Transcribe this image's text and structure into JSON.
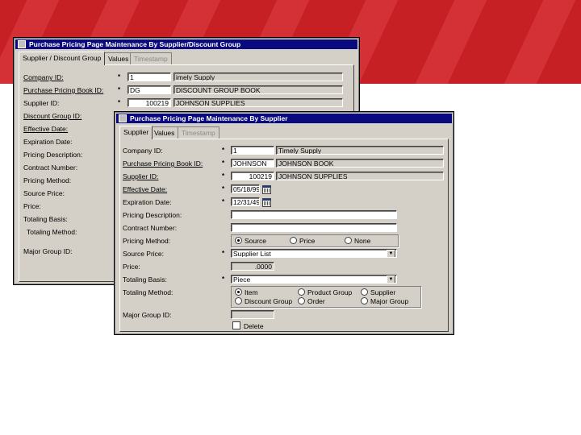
{
  "colors": {
    "banner": "#c62025",
    "titlebar": "#0a0a80",
    "window": "#d4d0c8"
  },
  "back_window": {
    "title": "Purchase Pricing Page Maintenance By Supplier/Discount Group",
    "tabs": [
      {
        "label": "Supplier / Discount Group",
        "active": true
      },
      {
        "label": "Values"
      },
      {
        "label": "Timestamp",
        "disabled": true
      }
    ],
    "fields": {
      "company_id": {
        "label": "Company ID:",
        "value": "1",
        "desc": "imely Supply"
      },
      "price_book_id": {
        "label": "Purchase Pricing Book ID:",
        "value": "DG",
        "desc": "DISCOUNT GROUP BOOK"
      },
      "supplier_id": {
        "label": "Supplier ID:",
        "value": "100219",
        "desc": "JOHNSON SUPPLIES"
      },
      "discount_group_id": {
        "label": "Discount Group ID:"
      },
      "effective_date": {
        "label": "Effective Date:"
      },
      "expiration_date": {
        "label": "Expiration Date:"
      },
      "pricing_description": {
        "label": "Pricing Description:"
      },
      "contract_number": {
        "label": "Contract Number:"
      },
      "pricing_method": {
        "label": "Pricing Method:"
      },
      "source_price": {
        "label": "Source Price:"
      },
      "price": {
        "label": "Price:"
      },
      "totaling_basis": {
        "label": "Totaling Basis:"
      },
      "totaling_method": {
        "label": "Totaling Method:"
      },
      "major_group_id": {
        "label": "Major Group ID:"
      }
    },
    "required_mark": "*"
  },
  "front_window": {
    "title": "Purchase Pricing Page Maintenance By Supplier",
    "tabs": [
      {
        "label": "Supplier",
        "active": true
      },
      {
        "label": "Values"
      },
      {
        "label": "Timestamp",
        "disabled": true
      }
    ],
    "required_mark": "*",
    "fields": {
      "company_id": {
        "label": "Company ID:",
        "value": "1",
        "desc": "Timely Supply"
      },
      "price_book_id": {
        "label": "Purchase Pricing Book ID:",
        "value": "JOHNSON",
        "desc": "JOHNSON BOOK"
      },
      "supplier_id": {
        "label": "Supplier ID:",
        "value": "100219",
        "desc": "JOHNSON SUPPLIES"
      },
      "effective_date": {
        "label": "Effective Date:",
        "value": "05/18/99"
      },
      "expiration_date": {
        "label": "Expiration Date:",
        "value": "12/31/49"
      },
      "pricing_description": {
        "label": "Pricing Description:",
        "value": ""
      },
      "contract_number": {
        "label": "Contract Number:",
        "value": ""
      },
      "pricing_method": {
        "label": "Pricing Method:",
        "options": [
          "Source",
          "Price",
          "None"
        ],
        "selected": "Source"
      },
      "source_price": {
        "label": "Source Price:",
        "value": "Supplier List"
      },
      "price": {
        "label": "Price:",
        "value": ".0000"
      },
      "totaling_basis": {
        "label": "Totaling Basis:",
        "value": "Piece"
      },
      "totaling_method": {
        "label": "Totaling Method:",
        "options": [
          "Item",
          "Product Group",
          "Supplier",
          "Discount Group",
          "Order",
          "Major Group"
        ],
        "selected": "Item"
      },
      "major_group_id": {
        "label": "Major Group ID:",
        "value": ""
      },
      "delete": {
        "label": "Delete",
        "checked": false
      }
    },
    "icons": {
      "calendar": "calendar-icon",
      "dropdown": "dropdown-arrow-icon"
    }
  }
}
